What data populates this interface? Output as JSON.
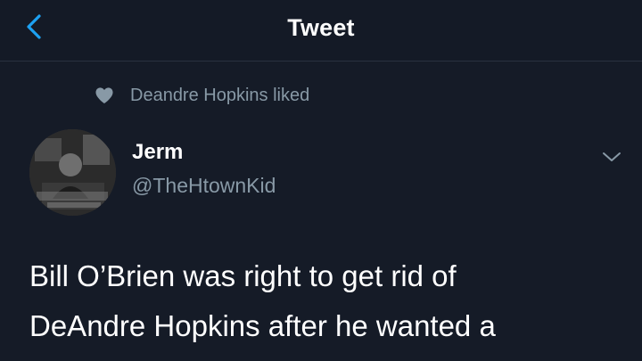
{
  "header": {
    "title": "Tweet",
    "back_icon": "chevron-left-icon",
    "accent_color": "#1da1f2"
  },
  "social_context": {
    "icon": "heart-icon",
    "text": "Deandre Hopkins liked"
  },
  "tweet": {
    "author": {
      "display_name": "Jerm",
      "handle": "@TheHtownKid"
    },
    "menu_icon": "chevron-down-icon",
    "text_lines": [
      "Bill O’Brien was right to get rid of",
      "DeAndre Hopkins after he wanted a"
    ]
  },
  "colors": {
    "background": "#151b27",
    "secondary_text": "#8899a6",
    "primary_text": "#ffffff"
  }
}
